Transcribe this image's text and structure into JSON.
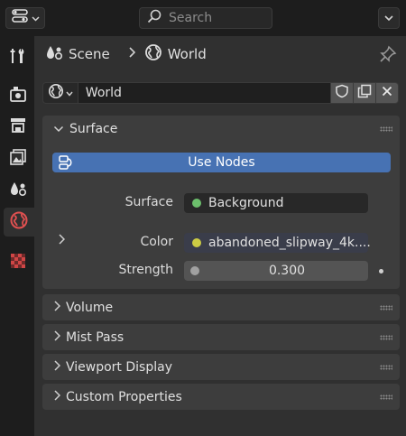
{
  "topbar": {
    "search_placeholder": "Search",
    "editor_icon": "properties-editor-icon",
    "menu_icon": "chevron-down-icon"
  },
  "sidebar": {
    "tabs": [
      {
        "icon": "tool-icon",
        "active": false
      },
      {
        "icon": "render-icon",
        "active": false
      },
      {
        "icon": "output-icon",
        "active": false
      },
      {
        "icon": "view-layer-icon",
        "active": false
      },
      {
        "icon": "scene-icon",
        "active": false
      },
      {
        "icon": "world-icon",
        "active": true
      },
      {
        "icon": "texture-icon",
        "active": false
      }
    ]
  },
  "breadcrumb": {
    "scene_label": "Scene",
    "world_label": "World",
    "separator_icon": "chevron-right-icon",
    "pin_icon": "pin-icon"
  },
  "world_selector": {
    "name": "World",
    "type_icon": "world-icon",
    "buttons": [
      "fake-user-shield-icon",
      "duplicate-icon",
      "unlink-x-icon"
    ]
  },
  "panels": {
    "surface": {
      "title": "Surface",
      "expanded": true,
      "use_nodes_label": "Use Nodes",
      "surface_label": "Surface",
      "surface_value": "Background",
      "surface_dot_color": "#6cbf6c",
      "color_label": "Color",
      "color_value": "abandoned_slipway_4k....",
      "color_dot_color": "#cccc44",
      "strength_label": "Strength",
      "strength_value": "0.300",
      "strength_dot_color": "#a1a1a1"
    },
    "collapsed": [
      {
        "title": "Volume"
      },
      {
        "title": "Mist Pass"
      },
      {
        "title": "Viewport Display"
      },
      {
        "title": "Custom Properties"
      }
    ]
  },
  "colors": {
    "accent": "#4772b3",
    "world_tab_icon": "#e05050",
    "texture_tab_icon": "#c04040",
    "panel_bg": "#3d3d3d",
    "editor_bg": "#303030"
  }
}
